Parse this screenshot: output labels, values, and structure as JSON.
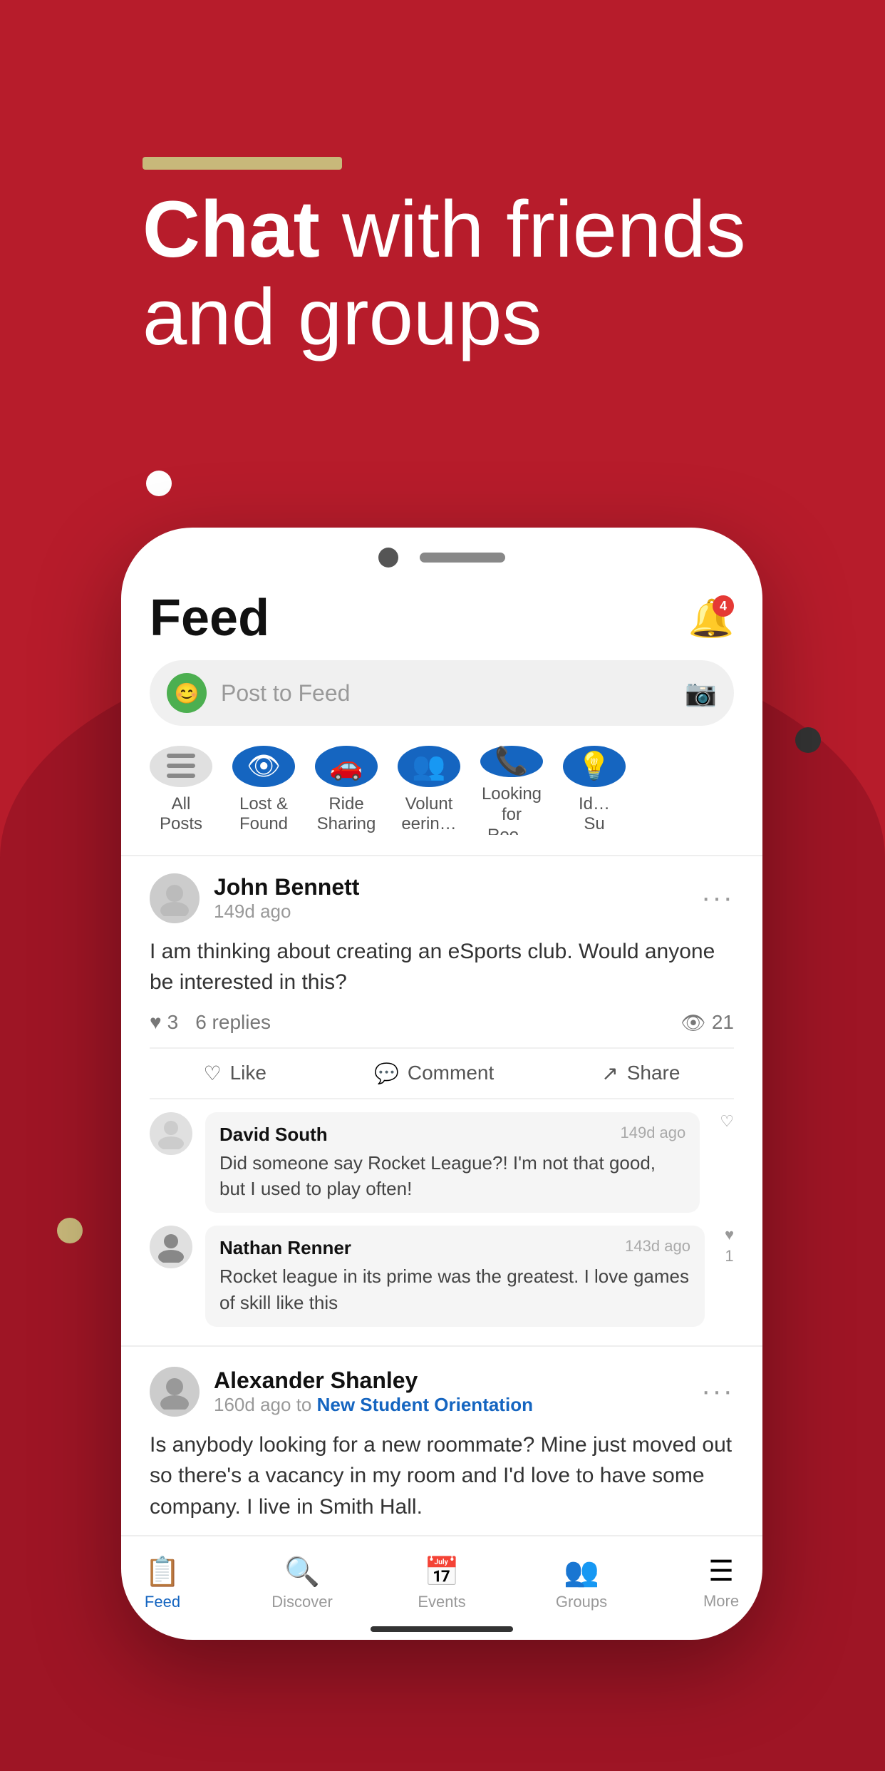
{
  "background": {
    "color": "#b71c2b"
  },
  "hero": {
    "accent_bar": "accent-bar",
    "title_bold": "Chat",
    "title_rest": " with friends\nand groups"
  },
  "phone": {
    "feed_title": "Feed",
    "notif_count": "4",
    "post_bar": {
      "placeholder": "Post to Feed",
      "camera_icon": "📷"
    },
    "categories": [
      {
        "label": "All Posts",
        "icon": "☰",
        "style": "gray"
      },
      {
        "label": "Lost &\nFound",
        "icon": "👁",
        "style": "blue"
      },
      {
        "label": "Ride\nSharing",
        "icon": "🚗",
        "style": "blue"
      },
      {
        "label": "Volunt\neerin…",
        "icon": "👥",
        "style": "blue"
      },
      {
        "label": "Looking\nfor Roo…",
        "icon": "📞",
        "style": "blue"
      },
      {
        "label": "Id…\nSu",
        "icon": "?",
        "style": "blue"
      }
    ],
    "post1": {
      "author": "John Bennett",
      "time": "149d ago",
      "body": "I am thinking about creating an eSports club. Would anyone be interested in this?",
      "likes": "3",
      "replies": "6 replies",
      "views": "21",
      "actions": [
        "Like",
        "Comment",
        "Share"
      ],
      "comments": [
        {
          "author": "David South",
          "time": "149d ago",
          "text": "Did someone say Rocket League?! I'm not that good, but I used to play often!"
        },
        {
          "author": "Nathan Renner",
          "time": "143d ago",
          "text": "Rocket league in its prime was the greatest. I love games of skill like this",
          "likes": "1"
        }
      ]
    },
    "post2": {
      "author": "Alexander Shanley",
      "time": "160d ago",
      "group": "New Student Orientation",
      "body": "Is anybody looking for a new roommate? Mine just moved out so there's a vacancy in my room and I'd love to have some company. I live in Smith Hall."
    },
    "bottom_nav": [
      {
        "label": "Feed",
        "icon": "📋",
        "active": true
      },
      {
        "label": "Discover",
        "icon": "🔍",
        "active": false
      },
      {
        "label": "Events",
        "icon": "📅",
        "active": false
      },
      {
        "label": "Groups",
        "icon": "👥",
        "active": false
      },
      {
        "label": "More",
        "icon": "☰",
        "active": false
      }
    ]
  }
}
